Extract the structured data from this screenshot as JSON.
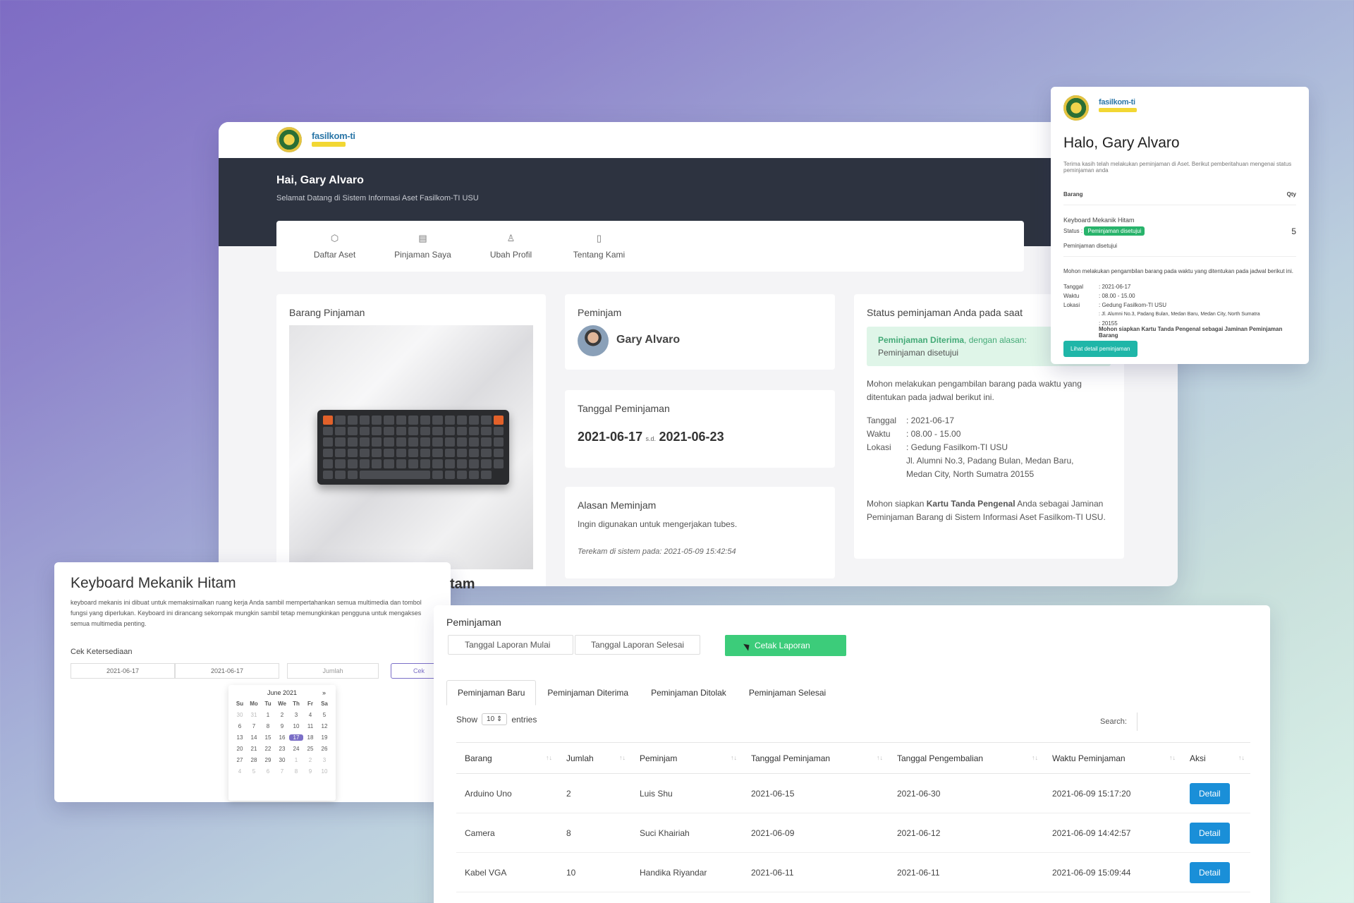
{
  "brand": {
    "logo_text": "fasilkom-ti"
  },
  "main": {
    "greeting": "Hai, Gary Alvaro",
    "subtitle": "Selamat Datang di Sistem Informasi Aset Fasilkom-TI USU",
    "nav": [
      {
        "label": "Daftar Aset",
        "icon": "box-icon"
      },
      {
        "label": "Pinjaman Saya",
        "icon": "document-icon"
      },
      {
        "label": "Ubah Profil",
        "icon": "user-icon"
      },
      {
        "label": "Tentang Kami",
        "icon": "book-icon"
      }
    ],
    "barang": {
      "title": "Barang Pinjaman",
      "caption_fragment": "tam"
    },
    "peminjam": {
      "title": "Peminjam",
      "name": "Gary Alvaro"
    },
    "tanggal": {
      "title": "Tanggal Peminjaman",
      "start": "2021-06-17",
      "sep": "s.d.",
      "end": "2021-06-23"
    },
    "alasan": {
      "title": "Alasan Meminjam",
      "text": "Ingin digunakan untuk mengerjakan tubes.",
      "recorded": "Terekam di sistem pada: 2021-05-09 15:42:54"
    },
    "status": {
      "title": "Status peminjaman Anda pada saat",
      "accepted_label": "Peminjaman Diterima",
      "accepted_suffix": ", dengan alasan:",
      "reason": "Peminjaman disetujui",
      "instruction": "Mohon melakukan pengambilan barang pada waktu yang ditentukan pada jadwal berikut ini.",
      "rows": [
        {
          "k": "Tanggal",
          "v": ": 2021-06-17"
        },
        {
          "k": "Waktu",
          "v": ": 08.00 - 15.00"
        },
        {
          "k": "Lokasi",
          "v": ": Gedung Fasilkom-TI USU"
        }
      ],
      "address": "Jl. Alumni No.3, Padang Bulan, Medan Baru, Medan City, North Sumatra 20155",
      "footer_pre": "Mohon siapkan ",
      "footer_bold": "Kartu Tanda Pengenal",
      "footer_post": " Anda sebagai Jaminan Peminjaman Barang di Sistem Informasi Aset Fasilkom-TI USU."
    }
  },
  "email": {
    "title": "Halo, Gary Alvaro",
    "intro": "Terima kasih telah melakukan peminjaman di Aset. Berikut pemberitahuan mengenai status peminjaman anda",
    "col_item": "Barang",
    "col_qty": "Qty",
    "item": "Keyboard Mekanik Hitam",
    "status_label": "Status :",
    "status_value": "Peminjaman disetujui",
    "qty": "5",
    "note": "Peminjaman disetujui",
    "instruction": "Mohon melakukan pengambilan barang pada waktu yang ditentukan pada jadwal berikut ini.",
    "rows": [
      {
        "k": "Tanggal",
        "v": ": 2021-06-17"
      },
      {
        "k": "Waktu",
        "v": ": 08.00 - 15.00"
      },
      {
        "k": "Lokasi",
        "v": ": Gedung Fasilkom-TI USU"
      },
      {
        "k": "",
        "v": ": Jl. Alumni No.3, Padang Bulan, Medan Baru, Medan City, North Sumatra"
      },
      {
        "k": "",
        "v": ": 20155"
      }
    ],
    "footer": "Mohon siapkan Kartu Tanda Pengenal sebagai Jaminan Peminjaman Barang",
    "button": "Lihat detail peminjaman"
  },
  "detail": {
    "title": "Keyboard Mekanik Hitam",
    "desc": "keyboard mekanis ini dibuat untuk memaksimalkan ruang kerja Anda sambil mempertahankan semua multimedia dan tombol fungsi yang diperlukan. Keyboard ini dirancang sekompak mungkin sambil tetap memungkinkan pengguna untuk mengakses semua multimedia penting.",
    "check_label": "Cek Ketersediaan",
    "date_from": "2021-06-17",
    "date_to": "2021-06-17",
    "qty_placeholder": "Jumlah",
    "check_btn": "Cek",
    "calendar": {
      "month": "June 2021",
      "next": "»",
      "days": [
        "Su",
        "Mo",
        "Tu",
        "We",
        "Th",
        "Fr",
        "Sa"
      ],
      "cells": [
        "30",
        "31",
        "1",
        "2",
        "3",
        "4",
        "5",
        "6",
        "7",
        "8",
        "9",
        "10",
        "11",
        "12",
        "13",
        "14",
        "15",
        "16",
        "17",
        "18",
        "19",
        "20",
        "21",
        "22",
        "23",
        "24",
        "25",
        "26",
        "27",
        "28",
        "29",
        "30",
        "1",
        "2",
        "3",
        "4",
        "5",
        "6",
        "7",
        "8",
        "9",
        "10"
      ]
    }
  },
  "report": {
    "title": "Peminjaman",
    "start_ph": "Tanggal Laporan Mulai",
    "end_ph": "Tanggal Laporan Selesai",
    "print_btn": "Cetak Laporan",
    "tabs": [
      "Peminjaman Baru",
      "Peminjaman Diterima",
      "Peminjaman Ditolak",
      "Peminjaman Selesai"
    ],
    "show": "Show",
    "entries_val": "10",
    "entries": "entries",
    "search": "Search:",
    "columns": [
      "Barang",
      "Jumlah",
      "Peminjam",
      "Tanggal Peminjaman",
      "Tanggal Pengembalian",
      "Waktu Peminjaman",
      "Aksi"
    ],
    "rows": [
      [
        "Arduino Uno",
        "2",
        "Luis Shu",
        "2021-06-15",
        "2021-06-30",
        "2021-06-09 15:17:20",
        "Detail"
      ],
      [
        "Camera",
        "8",
        "Suci Khairiah",
        "2021-06-09",
        "2021-06-12",
        "2021-06-09 14:42:57",
        "Detail"
      ],
      [
        "Kabel VGA",
        "10",
        "Handika Riyandar",
        "2021-06-11",
        "2021-06-11",
        "2021-06-09 15:09:44",
        "Detail"
      ]
    ]
  }
}
